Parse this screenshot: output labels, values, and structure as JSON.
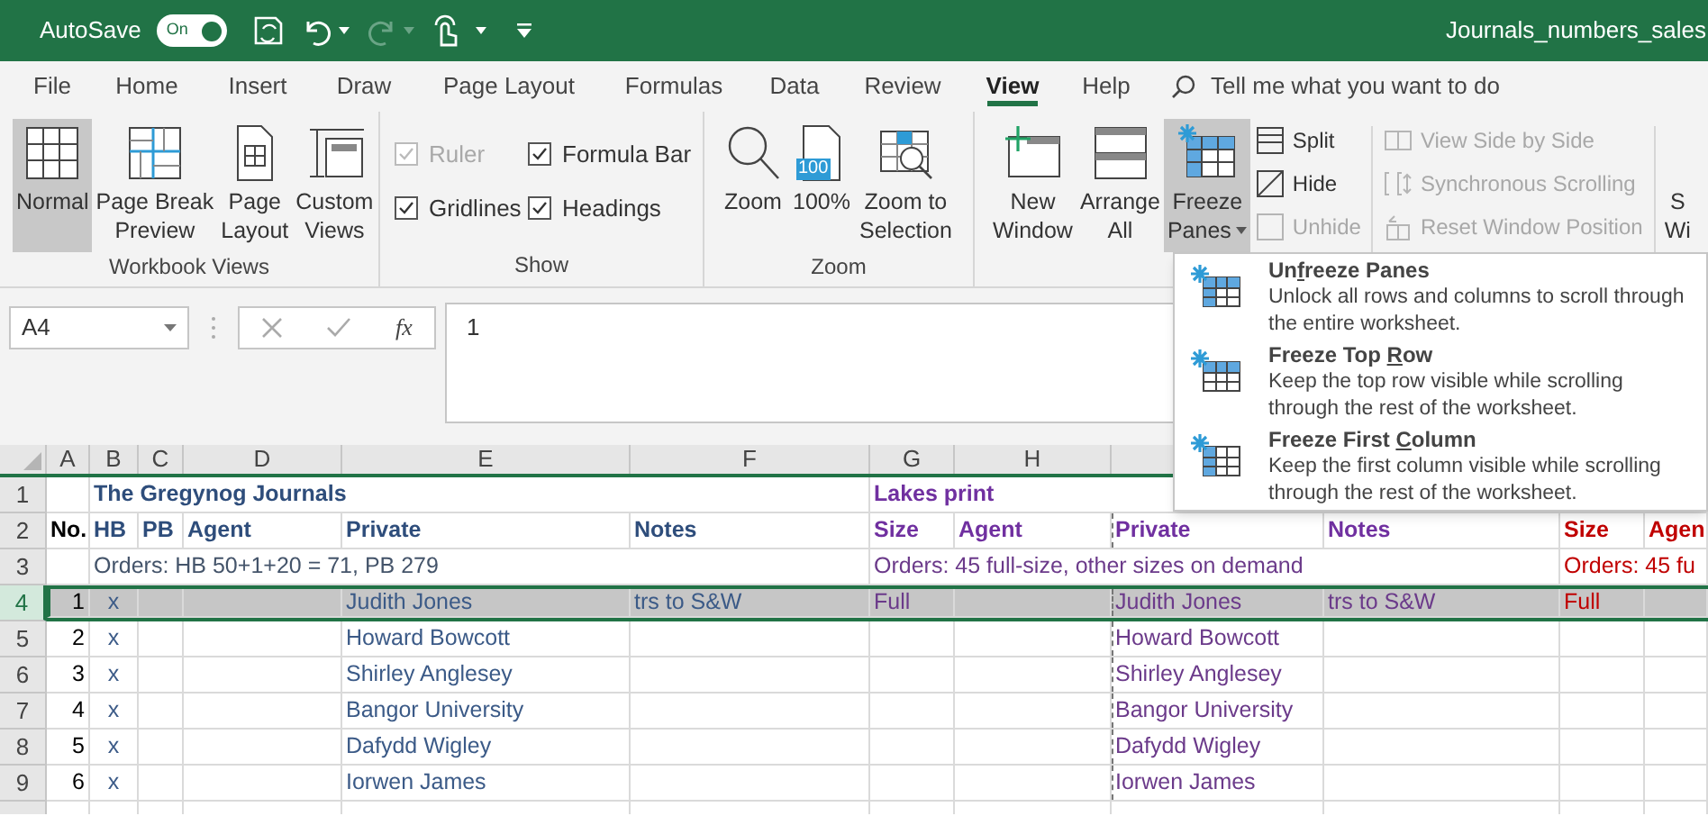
{
  "title_bar": {
    "autosave_label": "AutoSave",
    "autosave_toggle": "On",
    "autosave_on": true,
    "file_name": "Journals_numbers_sales"
  },
  "menu_tabs": [
    {
      "label": "File",
      "selected": false
    },
    {
      "label": "Home",
      "selected": false
    },
    {
      "label": "Insert",
      "selected": false
    },
    {
      "label": "Draw",
      "selected": false
    },
    {
      "label": "Page Layout",
      "selected": false
    },
    {
      "label": "Formulas",
      "selected": false
    },
    {
      "label": "Data",
      "selected": false
    },
    {
      "label": "Review",
      "selected": false
    },
    {
      "label": "View",
      "selected": true
    },
    {
      "label": "Help",
      "selected": false
    }
  ],
  "search": {
    "placeholder": "Tell me what you want to do"
  },
  "ribbon_groups": [
    {
      "label": "Workbook Views",
      "items": [
        {
          "kind": "large",
          "lines": [
            "Normal"
          ],
          "selected": true
        },
        {
          "kind": "large",
          "lines": [
            "Page Break",
            "Preview"
          ],
          "selected": false
        },
        {
          "kind": "large",
          "lines": [
            "Page",
            "Layout"
          ],
          "selected": false
        },
        {
          "kind": "large",
          "lines": [
            "Custom",
            "Views"
          ],
          "selected": false
        }
      ]
    },
    {
      "label": "Show",
      "items": [
        {
          "kind": "checkbox",
          "label": "Ruler",
          "checked": true,
          "disabled": true
        },
        {
          "kind": "checkbox",
          "label": "Formula Bar",
          "checked": true,
          "disabled": false
        },
        {
          "kind": "checkbox",
          "label": "Gridlines",
          "checked": true,
          "disabled": false
        },
        {
          "kind": "checkbox",
          "label": "Headings",
          "checked": true,
          "disabled": false
        }
      ]
    },
    {
      "label": "Zoom",
      "items": [
        {
          "kind": "large",
          "lines": [
            "Zoom"
          ],
          "selected": false
        },
        {
          "kind": "large",
          "lines": [
            "100%"
          ],
          "selected": false,
          "badge": "100"
        },
        {
          "kind": "large",
          "lines": [
            "Zoom to",
            "Selection"
          ],
          "selected": false
        }
      ]
    },
    {
      "items": [
        {
          "kind": "large",
          "lines": [
            "New",
            "Window"
          ],
          "selected": false
        },
        {
          "kind": "large",
          "lines": [
            "Arrange",
            "All"
          ],
          "selected": false
        },
        {
          "kind": "large",
          "lines": [
            "Freeze",
            "Panes"
          ],
          "selected": true,
          "dropdown": true
        },
        {
          "kind": "small",
          "label": "Split",
          "disabled": false
        },
        {
          "kind": "small",
          "label": "Hide",
          "disabled": false
        },
        {
          "kind": "small",
          "label": "Unhide",
          "disabled": true
        },
        {
          "kind": "small",
          "label": "View Side by Side",
          "disabled": true
        },
        {
          "kind": "small",
          "label": "Synchronous Scrolling",
          "disabled": true
        },
        {
          "kind": "small",
          "label": "Reset Window Position",
          "disabled": true
        },
        {
          "kind": "large",
          "lines": [
            "S",
            "Wi"
          ],
          "selected": false
        }
      ]
    }
  ],
  "formula_bar": {
    "name_box": "A4",
    "function_label": "fx",
    "value": "1"
  },
  "sheet": {
    "columns": [
      "A",
      "B",
      "C",
      "D",
      "E",
      "F",
      "G",
      "H"
    ],
    "rows": [
      {
        "number": "1",
        "kind": "title",
        "selected": false,
        "cells": [
          {},
          {
            "text": "The Gregynog Journals",
            "bold": true,
            "color": "#2e4d7b"
          },
          {},
          {},
          {},
          {},
          {
            "text": "Lakes print",
            "bold": true,
            "color": "#7030a0"
          },
          {},
          {},
          {},
          {},
          {}
        ]
      },
      {
        "number": "2",
        "kind": "header",
        "selected": false,
        "cells": [
          {
            "text": "No.",
            "bold": true,
            "color": "#000000"
          },
          {
            "text": "HB",
            "bold": true,
            "color": "#2e4d7b"
          },
          {
            "text": "PB",
            "bold": true,
            "color": "#2e4d7b"
          },
          {
            "text": "Agent",
            "bold": true,
            "color": "#2e4d7b"
          },
          {
            "text": "Private",
            "bold": true,
            "color": "#2e4d7b"
          },
          {
            "text": "Notes",
            "bold": true,
            "color": "#2e4d7b"
          },
          {
            "text": "Size",
            "bold": true,
            "color": "#7030a0"
          },
          {
            "text": "Agent",
            "bold": true,
            "color": "#7030a0"
          },
          {
            "text": "Private",
            "bold": true,
            "color": "#7030a0"
          },
          {
            "text": "Notes",
            "bold": true,
            "color": "#7030a0"
          },
          {
            "text": "Size",
            "bold": true,
            "color": "#c00000"
          },
          {
            "text": "Agen",
            "bold": true,
            "color": "#c00000"
          }
        ]
      },
      {
        "number": "3",
        "kind": "note",
        "selected": false,
        "cells": [
          {},
          {
            "text": "Orders: HB 50+1+20 = 71, PB 279",
            "bold": false,
            "color": "#44546a"
          },
          {},
          {},
          {},
          {},
          {
            "text": "Orders: 45 full-size, other sizes on demand",
            "bold": false,
            "color": "#6b3a8a"
          },
          {},
          {},
          {},
          {
            "text": "Orders: 45 fu",
            "bold": false,
            "color": "#c00000"
          },
          {}
        ]
      },
      {
        "number": "4",
        "kind": "entry",
        "selected": true,
        "cells": [
          {
            "text": "1",
            "bold": false,
            "color": "#000000"
          },
          {
            "text": "x",
            "bold": false,
            "color": "#3b5a87"
          },
          {},
          {},
          {
            "text": "Judith Jones",
            "bold": false,
            "color": "#3b5a87"
          },
          {
            "text": "trs to S&W",
            "bold": false,
            "color": "#3b5a87"
          },
          {
            "text": "Full",
            "bold": false,
            "color": "#6b3a8a"
          },
          {},
          {
            "text": "Judith Jones",
            "bold": false,
            "color": "#6b3a8a"
          },
          {
            "text": "trs to S&W",
            "bold": false,
            "color": "#6b3a8a"
          },
          {
            "text": "Full",
            "bold": false,
            "color": "#c00000"
          },
          {}
        ]
      },
      {
        "number": "5",
        "kind": "entry",
        "selected": false,
        "cells": [
          {
            "text": "2",
            "bold": false,
            "color": "#000000"
          },
          {
            "text": "x",
            "bold": false,
            "color": "#3b5a87"
          },
          {},
          {},
          {
            "text": "Howard Bowcott",
            "bold": false,
            "color": "#3b5a87"
          },
          {},
          {},
          {},
          {
            "text": "Howard Bowcott",
            "bold": false,
            "color": "#6b3a8a"
          },
          {},
          {},
          {}
        ]
      },
      {
        "number": "6",
        "kind": "entry",
        "selected": false,
        "cells": [
          {
            "text": "3",
            "bold": false,
            "color": "#000000"
          },
          {
            "text": "x",
            "bold": false,
            "color": "#3b5a87"
          },
          {},
          {},
          {
            "text": "Shirley Anglesey",
            "bold": false,
            "color": "#3b5a87"
          },
          {},
          {},
          {},
          {
            "text": "Shirley Anglesey",
            "bold": false,
            "color": "#6b3a8a"
          },
          {},
          {},
          {}
        ]
      },
      {
        "number": "7",
        "kind": "entry",
        "selected": false,
        "cells": [
          {
            "text": "4",
            "bold": false,
            "color": "#000000"
          },
          {
            "text": "x",
            "bold": false,
            "color": "#3b5a87"
          },
          {},
          {},
          {
            "text": "Bangor University",
            "bold": false,
            "color": "#3b5a87"
          },
          {},
          {},
          {},
          {
            "text": "Bangor University",
            "bold": false,
            "color": "#6b3a8a"
          },
          {},
          {},
          {}
        ]
      },
      {
        "number": "8",
        "kind": "entry",
        "selected": false,
        "cells": [
          {
            "text": "5",
            "bold": false,
            "color": "#000000"
          },
          {
            "text": "x",
            "bold": false,
            "color": "#3b5a87"
          },
          {},
          {},
          {
            "text": "Dafydd Wigley",
            "bold": false,
            "color": "#3b5a87"
          },
          {},
          {},
          {},
          {
            "text": "Dafydd Wigley",
            "bold": false,
            "color": "#6b3a8a"
          },
          {},
          {},
          {}
        ]
      },
      {
        "number": "9",
        "kind": "entry",
        "selected": false,
        "cells": [
          {
            "text": "6",
            "bold": false,
            "color": "#000000"
          },
          {
            "text": "x",
            "bold": false,
            "color": "#3b5a87"
          },
          {},
          {},
          {
            "text": "Iorwen James",
            "bold": false,
            "color": "#3b5a87"
          },
          {},
          {},
          {},
          {
            "text": "Iorwen James",
            "bold": false,
            "color": "#6b3a8a"
          },
          {},
          {},
          {}
        ]
      }
    ]
  },
  "freeze_menu": [
    {
      "title_before": "Un",
      "access_key": "f",
      "title_after": "reeze Panes",
      "description": "Unlock all rows and columns to scroll through the entire worksheet."
    },
    {
      "title_before": "Freeze Top ",
      "access_key": "R",
      "title_after": "ow",
      "description": "Keep the top row visible while scrolling through the rest of the worksheet."
    },
    {
      "title_before": "Freeze First ",
      "access_key": "C",
      "title_after": "olumn",
      "description": "Keep the first column visible while scrolling through the rest of the worksheet."
    }
  ]
}
